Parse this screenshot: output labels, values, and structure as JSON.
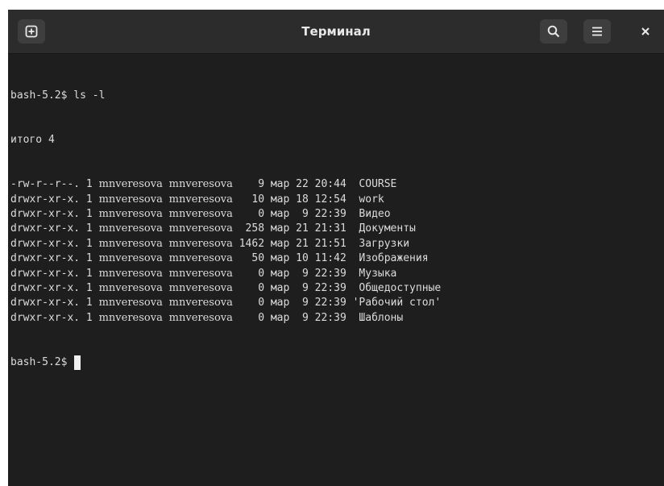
{
  "window": {
    "title": "Терминал",
    "icons": {
      "new_tab": "plus-square-icon",
      "search": "search-icon",
      "menu": "hamburger-menu-icon",
      "close": "close-icon"
    }
  },
  "terminal": {
    "prompt": "bash-5.2$",
    "command": "ls -l",
    "total": "итого 4",
    "listing": [
      {
        "perms": "-rw-r--r--.",
        "links": "1",
        "owner": "mnveresova",
        "group": "mnveresova",
        "size": "9",
        "month": "мар",
        "day": "22",
        "time": "20:44",
        "name": "COURSE"
      },
      {
        "perms": "drwxr-xr-x.",
        "links": "1",
        "owner": "mnveresova",
        "group": "mnveresova",
        "size": "10",
        "month": "мар",
        "day": "18",
        "time": "12:54",
        "name": "work"
      },
      {
        "perms": "drwxr-xr-x.",
        "links": "1",
        "owner": "mnveresova",
        "group": "mnveresova",
        "size": "0",
        "month": "мар",
        "day": "9",
        "time": "22:39",
        "name": "Видео"
      },
      {
        "perms": "drwxr-xr-x.",
        "links": "1",
        "owner": "mnveresova",
        "group": "mnveresova",
        "size": "258",
        "month": "мар",
        "day": "21",
        "time": "21:31",
        "name": "Документы"
      },
      {
        "perms": "drwxr-xr-x.",
        "links": "1",
        "owner": "mnveresova",
        "group": "mnveresova",
        "size": "1462",
        "month": "мар",
        "day": "21",
        "time": "21:51",
        "name": "Загрузки"
      },
      {
        "perms": "drwxr-xr-x.",
        "links": "1",
        "owner": "mnveresova",
        "group": "mnveresova",
        "size": "50",
        "month": "мар",
        "day": "10",
        "time": "11:42",
        "name": "Изображения"
      },
      {
        "perms": "drwxr-xr-x.",
        "links": "1",
        "owner": "mnveresova",
        "group": "mnveresova",
        "size": "0",
        "month": "мар",
        "day": "9",
        "time": "22:39",
        "name": "Музыка"
      },
      {
        "perms": "drwxr-xr-x.",
        "links": "1",
        "owner": "mnveresova",
        "group": "mnveresova",
        "size": "0",
        "month": "мар",
        "day": "9",
        "time": "22:39",
        "name": "Общедоступные"
      },
      {
        "perms": "drwxr-xr-x.",
        "links": "1",
        "owner": "mnveresova",
        "group": "mnveresova",
        "size": "0",
        "month": "мар",
        "day": "9",
        "time": "22:39",
        "name": "'Рабочий стол'"
      },
      {
        "perms": "drwxr-xr-x.",
        "links": "1",
        "owner": "mnveresova",
        "group": "mnveresova",
        "size": "0",
        "month": "мар",
        "day": "9",
        "time": "22:39",
        "name": "Шаблоны"
      }
    ],
    "final_prompt": "bash-5.2$"
  }
}
